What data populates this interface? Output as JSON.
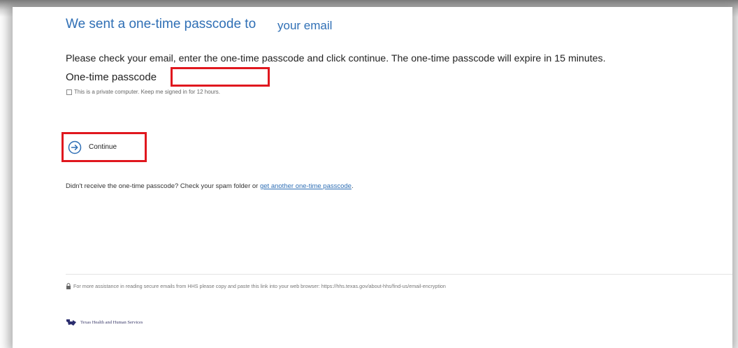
{
  "header": {
    "heading": "We sent a one-time passcode to",
    "email": "your email"
  },
  "form": {
    "instructions": "Please check your email, enter the one-time passcode and click continue. The one-time passcode will expire in 15 minutes.",
    "passcode_label": "One-time passcode",
    "passcode_value": "",
    "private_computer_label": "This is a private computer. Keep me signed in for 12 hours.",
    "continue_label": "Continue"
  },
  "resend": {
    "text": "Didn't receive the one-time passcode? Check your spam folder or",
    "link": "get another one-time passcode",
    "suffix": "."
  },
  "footer": {
    "assistance": "For more assistance in reading secure emails from HHS please copy and paste this link into your web browser: https://hhs.texas.gov/about-hhs/find-us/email-encryption",
    "org_name": "Texas Health and Human Services"
  },
  "colors": {
    "heading_blue": "#2f6fb5",
    "highlight_red": "#e0171e"
  },
  "icons": {
    "continue": "arrow-right-circle-icon",
    "lock": "lock-icon",
    "logo": "texas-hhs-logo-icon"
  }
}
